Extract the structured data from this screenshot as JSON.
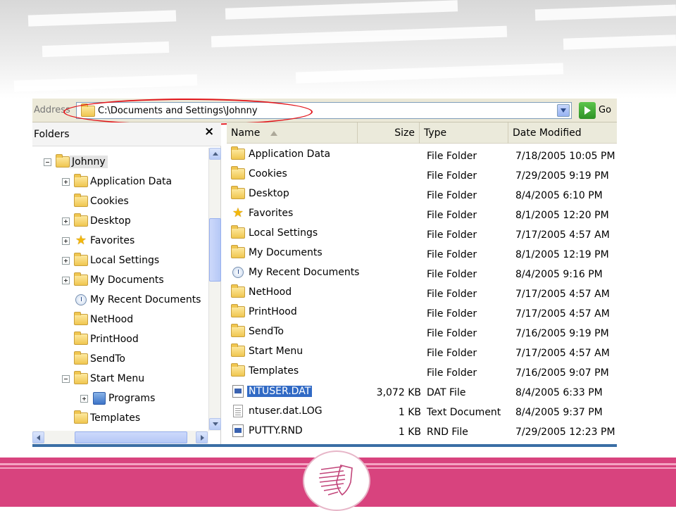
{
  "address": {
    "label": "Address",
    "path": "C:\\Documents and Settings\\Johnny",
    "go_label": "Go"
  },
  "folders_pane": {
    "title": "Folders",
    "close_glyph": "×",
    "tree": [
      {
        "label": "Johnny",
        "expander": "minus",
        "level": 0,
        "icon": "folder",
        "selected": true
      },
      {
        "label": "Application Data",
        "expander": "plus",
        "level": 1,
        "icon": "folder"
      },
      {
        "label": "Cookies",
        "expander": "none",
        "level": 1,
        "icon": "folder"
      },
      {
        "label": "Desktop",
        "expander": "plus",
        "level": 1,
        "icon": "folder"
      },
      {
        "label": "Favorites",
        "expander": "plus",
        "level": 1,
        "icon": "star"
      },
      {
        "label": "Local Settings",
        "expander": "plus",
        "level": 1,
        "icon": "folder"
      },
      {
        "label": "My Documents",
        "expander": "plus",
        "level": 1,
        "icon": "folder"
      },
      {
        "label": "My Recent Documents",
        "expander": "none",
        "level": 1,
        "icon": "recent"
      },
      {
        "label": "NetHood",
        "expander": "none",
        "level": 1,
        "icon": "folder"
      },
      {
        "label": "PrintHood",
        "expander": "none",
        "level": 1,
        "icon": "folder"
      },
      {
        "label": "SendTo",
        "expander": "none",
        "level": 1,
        "icon": "folder"
      },
      {
        "label": "Start Menu",
        "expander": "minus",
        "level": 1,
        "icon": "folder"
      },
      {
        "label": "Programs",
        "expander": "plus",
        "level": 2,
        "icon": "programs"
      },
      {
        "label": "Templates",
        "expander": "none",
        "level": 1,
        "icon": "folder"
      }
    ]
  },
  "file_list": {
    "columns": {
      "name": "Name",
      "size": "Size",
      "type": "Type",
      "date": "Date Modified"
    },
    "rows": [
      {
        "name": "Application Data",
        "size": "",
        "type": "File Folder",
        "date": "7/18/2005 10:05 PM",
        "icon": "folder"
      },
      {
        "name": "Cookies",
        "size": "",
        "type": "File Folder",
        "date": "7/29/2005 9:19 PM",
        "icon": "folder"
      },
      {
        "name": "Desktop",
        "size": "",
        "type": "File Folder",
        "date": "8/4/2005 6:10 PM",
        "icon": "folder"
      },
      {
        "name": "Favorites",
        "size": "",
        "type": "File Folder",
        "date": "8/1/2005 12:20 PM",
        "icon": "star"
      },
      {
        "name": "Local Settings",
        "size": "",
        "type": "File Folder",
        "date": "7/17/2005 4:57 AM",
        "icon": "folder"
      },
      {
        "name": "My Documents",
        "size": "",
        "type": "File Folder",
        "date": "8/1/2005 12:19 PM",
        "icon": "folder"
      },
      {
        "name": "My Recent Documents",
        "size": "",
        "type": "File Folder",
        "date": "8/4/2005 9:16 PM",
        "icon": "recent"
      },
      {
        "name": "NetHood",
        "size": "",
        "type": "File Folder",
        "date": "7/17/2005 4:57 AM",
        "icon": "folder"
      },
      {
        "name": "PrintHood",
        "size": "",
        "type": "File Folder",
        "date": "7/17/2005 4:57 AM",
        "icon": "folder"
      },
      {
        "name": "SendTo",
        "size": "",
        "type": "File Folder",
        "date": "7/16/2005 9:19 PM",
        "icon": "folder"
      },
      {
        "name": "Start Menu",
        "size": "",
        "type": "File Folder",
        "date": "7/17/2005 4:57 AM",
        "icon": "folder"
      },
      {
        "name": "Templates",
        "size": "",
        "type": "File Folder",
        "date": "7/16/2005 9:07 PM",
        "icon": "folder"
      },
      {
        "name": "NTUSER.DAT",
        "size": "3,072 KB",
        "type": "DAT File",
        "date": "8/4/2005 6:33 PM",
        "icon": "dat",
        "selected": true
      },
      {
        "name": "ntuser.dat.LOG",
        "size": "1 KB",
        "type": "Text Document",
        "date": "8/4/2005 9:37 PM",
        "icon": "log"
      },
      {
        "name": "PUTTY.RND",
        "size": "1 KB",
        "type": "RND File",
        "date": "7/29/2005 12:23 PM",
        "icon": "dat"
      }
    ]
  },
  "colors": {
    "highlight": "#e2161c",
    "selection": "#316ac5",
    "slide_accent": "#d8437e"
  }
}
